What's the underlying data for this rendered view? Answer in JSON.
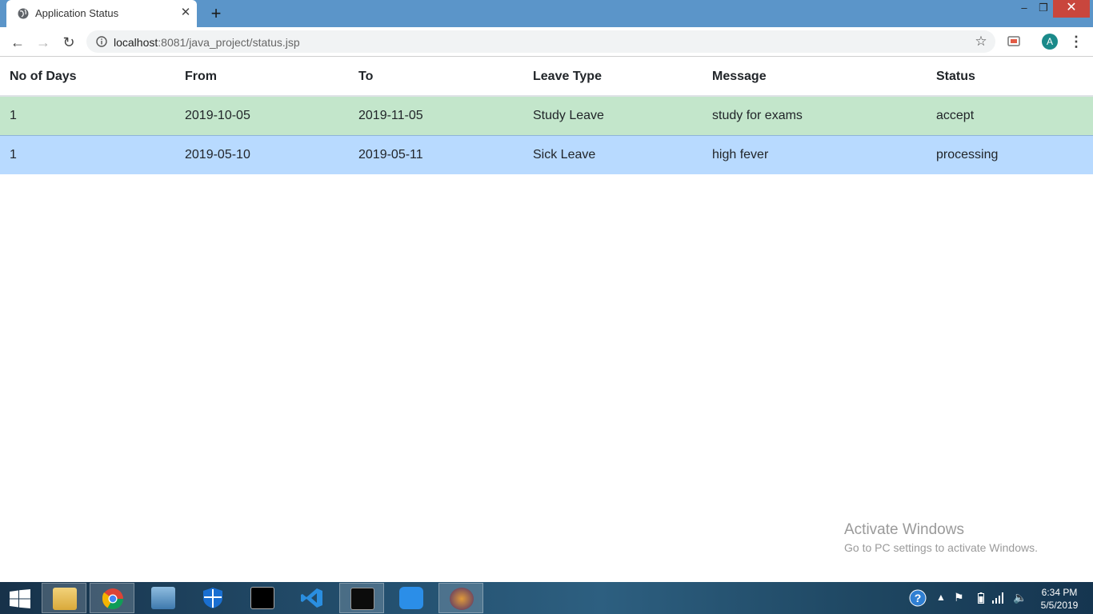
{
  "browser": {
    "tab_title": "Application Status",
    "tab_close": "✕",
    "new_tab": "+",
    "url_host": "localhost",
    "url_rest": ":8081/java_project/status.jsp",
    "avatar_letter": "A",
    "window_controls": {
      "minimize": "–",
      "maximize": "❐",
      "close": "✕"
    }
  },
  "table": {
    "headers": [
      "No of Days",
      "From",
      "To",
      "Leave Type",
      "Message",
      "Status"
    ],
    "rows": [
      {
        "days": "1",
        "from": "2019-10-05",
        "to": "2019-11-05",
        "type": "Study Leave",
        "message": "study for exams",
        "status": "accept",
        "row_color": "#c3e6cb"
      },
      {
        "days": "1",
        "from": "2019-05-10",
        "to": "2019-05-11",
        "type": "Sick Leave",
        "message": "high fever",
        "status": "processing",
        "row_color": "#b8daff"
      }
    ]
  },
  "watermark": {
    "title": "Activate Windows",
    "subtitle": "Go to PC settings to activate Windows."
  },
  "taskbar": {
    "apps": [
      "start-icon",
      "file-explorer-icon",
      "chrome-icon",
      "remote-desktop-icon",
      "defender-icon",
      "command-prompt-icon",
      "vscode-icon",
      "mysql-icon",
      "wps-icon",
      "java-ee-ide-icon"
    ],
    "time": "6:34 PM",
    "date": "5/5/2019"
  }
}
